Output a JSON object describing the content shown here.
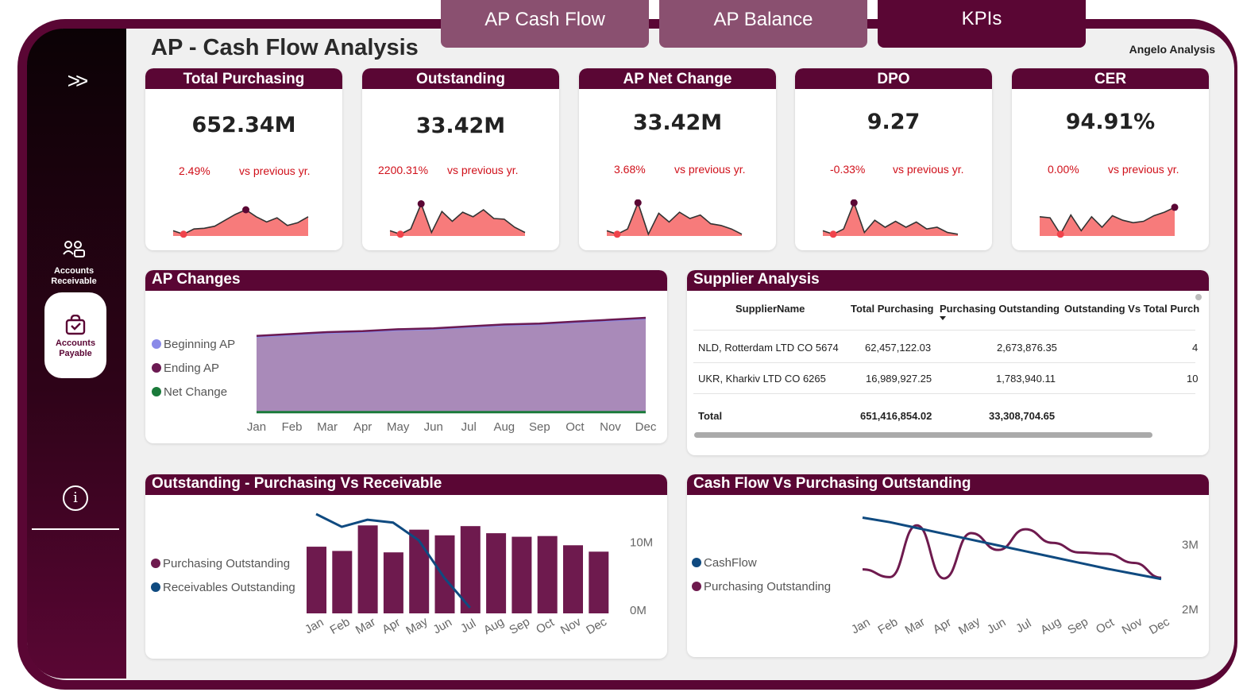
{
  "tabs": [
    {
      "label": "AP Cash Flow"
    },
    {
      "label": "AP Balance"
    },
    {
      "label": "KPIs"
    }
  ],
  "sidebar": {
    "expand_icon": ">>",
    "items": [
      {
        "label": "Accounts Receivable",
        "icon": "accounts-receivable-icon"
      },
      {
        "label": "Accounts Payable",
        "icon": "shopping-bag-icon",
        "active": true
      }
    ],
    "info_icon": "i"
  },
  "header": {
    "title": "AP - Cash Flow Analysis",
    "author": "Angelo Analysis"
  },
  "kpis": [
    {
      "title": "Total Purchasing",
      "value": "652.34M",
      "change": "2.49%",
      "vs_label": "vs previous yr."
    },
    {
      "title": "Outstanding",
      "value": "33.42M",
      "change": "2200.31%",
      "vs_label": "vs previous yr."
    },
    {
      "title": "AP Net Change",
      "value": "33.42M",
      "change": "3.68%",
      "vs_label": "vs previous yr."
    },
    {
      "title": "DPO",
      "value": "9.27",
      "change": "-0.33%",
      "vs_label": "vs previous yr."
    },
    {
      "title": "CER",
      "value": "94.91%",
      "change": "0.00%",
      "vs_label": "vs previous yr."
    }
  ],
  "colors": {
    "brand": "#5a0634",
    "negative": "#d0101a",
    "sparkline_fill": "#f77b7b",
    "beginning_ap": "#8a8ae8",
    "ending_ap": "#6b1a52",
    "net_change": "#1a7a3a",
    "area_fill": "#a98ab9",
    "bar": "#6e1a4e",
    "receivables_line": "#0f4a80"
  },
  "panels": {
    "ap_changes": {
      "title": "AP Changes"
    },
    "supplier": {
      "title": "Supplier Analysis"
    },
    "outstanding": {
      "title": "Outstanding - Purchasing Vs Receivable"
    },
    "cashflow": {
      "title": "Cash Flow Vs Purchasing Outstanding"
    }
  },
  "supplier_table": {
    "columns": [
      "SupplierName",
      "Total Purchasing",
      "Purchasing Outstanding",
      "Outstanding Vs Total Purch"
    ],
    "rows": [
      {
        "name": "NLD, Rotterdam LTD CO 5674",
        "total": "62,457,122.03",
        "outstanding": "2,673,876.35",
        "ratio": "4"
      },
      {
        "name": "UKR, Kharkiv LTD CO 6265",
        "total": "16,989,927.25",
        "outstanding": "1,783,940.11",
        "ratio": "10"
      }
    ],
    "total": {
      "label": "Total",
      "total": "651,416,854.02",
      "outstanding": "33,308,704.65"
    }
  },
  "chart_data": [
    {
      "type": "area",
      "id": "ap_changes",
      "categories": [
        "Jan",
        "Feb",
        "Mar",
        "Apr",
        "May",
        "Jun",
        "Jul",
        "Aug",
        "Sep",
        "Oct",
        "Nov",
        "Dec"
      ],
      "series": [
        {
          "name": "Beginning AP",
          "values": [
            0.8,
            0.82,
            0.84,
            0.85,
            0.87,
            0.88,
            0.9,
            0.92,
            0.93,
            0.95,
            0.97,
            0.99
          ]
        },
        {
          "name": "Ending AP",
          "values": [
            0.81,
            0.83,
            0.85,
            0.86,
            0.88,
            0.89,
            0.91,
            0.93,
            0.94,
            0.96,
            0.98,
            1.0
          ]
        },
        {
          "name": "Net Change",
          "values": [
            0.01,
            0.01,
            0.01,
            0.01,
            0.01,
            0.01,
            0.01,
            0.01,
            0.01,
            0.01,
            0.01,
            0.01
          ]
        }
      ],
      "legend": "left"
    },
    {
      "type": "bar",
      "id": "outstanding",
      "categories": [
        "Jan",
        "Feb",
        "Mar",
        "Apr",
        "May",
        "Jun",
        "Jul",
        "Aug",
        "Sep",
        "Oct",
        "Nov",
        "Dec"
      ],
      "series": [
        {
          "name": "Purchasing Outstanding",
          "values": [
            9.4,
            8.8,
            12.4,
            8.6,
            11.8,
            11.0,
            12.3,
            11.3,
            10.8,
            10.9,
            9.6,
            8.7
          ]
        },
        {
          "name": "Receivables Outstanding",
          "values": [
            14.0,
            12.2,
            13.2,
            12.8,
            10.3,
            5.0,
            0.8,
            null,
            null,
            null,
            null,
            null
          ]
        }
      ],
      "y_ticks": [
        "10M",
        "0M"
      ],
      "ylim": [
        0,
        14
      ],
      "legend": "left"
    },
    {
      "type": "line",
      "id": "cashflow",
      "categories": [
        "Jan",
        "Feb",
        "Mar",
        "Apr",
        "May",
        "Jun",
        "Jul",
        "Aug",
        "Sep",
        "Oct",
        "Nov",
        "Dec"
      ],
      "series": [
        {
          "name": "CashFlow",
          "values": [
            3.42,
            3.35,
            3.26,
            3.17,
            3.08,
            2.99,
            2.9,
            2.81,
            2.72,
            2.63,
            2.55,
            2.47
          ]
        },
        {
          "name": "Purchasing Outstanding",
          "values": [
            2.62,
            2.5,
            3.3,
            2.48,
            3.18,
            2.92,
            3.24,
            3.03,
            2.88,
            2.86,
            2.72,
            2.49
          ]
        }
      ],
      "y_ticks": [
        "3M",
        "2M"
      ],
      "ylim": [
        2,
        3.5
      ],
      "legend": "left"
    }
  ],
  "sparklines": [
    [
      0.15,
      0.05,
      0.2,
      0.22,
      0.28,
      0.45,
      0.62,
      0.75,
      0.55,
      0.4,
      0.52,
      0.3,
      0.38,
      0.55
    ],
    [
      0.15,
      0.05,
      0.2,
      0.92,
      0.1,
      0.7,
      0.42,
      0.68,
      0.55,
      0.75,
      0.5,
      0.48,
      0.25,
      0.1
    ],
    [
      0.15,
      0.05,
      0.2,
      0.95,
      0.05,
      0.65,
      0.4,
      0.68,
      0.5,
      0.6,
      0.35,
      0.3,
      0.2,
      0.05
    ],
    [
      0.15,
      0.05,
      0.2,
      0.95,
      0.1,
      0.45,
      0.25,
      0.42,
      0.25,
      0.4,
      0.2,
      0.25,
      0.1,
      0.05
    ],
    [
      0.55,
      0.52,
      0.05,
      0.6,
      0.15,
      0.55,
      0.25,
      0.58,
      0.45,
      0.38,
      0.42,
      0.58,
      0.68,
      0.82
    ]
  ]
}
